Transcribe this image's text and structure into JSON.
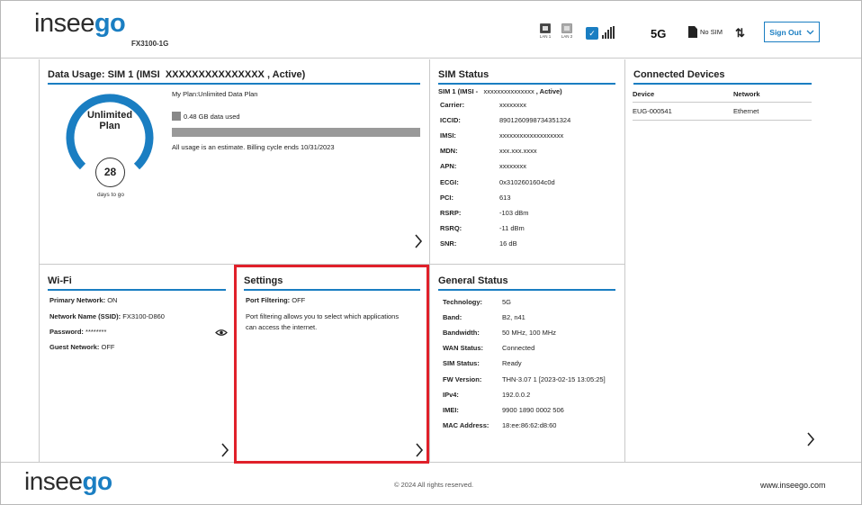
{
  "header": {
    "logo_text": "insee",
    "logo_accent": "go",
    "model": "FX3100-1G",
    "lan1_label": "LAN 1",
    "lan2_label": "LAN 2",
    "network_type": "5G",
    "sim_status": "No SIM",
    "sign_out_label": "Sign Out",
    "accent_color": "#1a7ec2"
  },
  "data_usage": {
    "title_prefix": "Data Usage:  SIM 1 (IMSI",
    "title_imsi": "XXXXXXXXXXXXXXX",
    "title_suffix": ", Active)",
    "gauge_line1": "Unlimited",
    "gauge_line2": "Plan",
    "days_remaining": "28",
    "days_label": "days to go",
    "plan": "My Plan:Unlimited Data Plan",
    "used": "0.48 GB data used",
    "usage_fraction": 0.0,
    "estimate_note": "All usage is an estimate. Billing cycle ends 10/31/2023"
  },
  "sim_status": {
    "title": "SIM Status",
    "sim_line_prefix": "SIM 1 (IMSI -",
    "sim_line_imsi": "xxxxxxxxxxxxxxx",
    "sim_line_suffix": ", Active)",
    "rows": [
      {
        "k": "Carrier:",
        "v": "xxxxxxxx"
      },
      {
        "k": "ICCID:",
        "v": "8901260998734351324"
      },
      {
        "k": "IMSI:",
        "v": "xxxxxxxxxxxxxxxxxxx"
      },
      {
        "k": "MDN:",
        "v": "xxx.xxx.xxxx"
      },
      {
        "k": "APN:",
        "v": "xxxxxxxx"
      },
      {
        "k": "ECGI:",
        "v": "0x3102601604c0d"
      },
      {
        "k": "PCI:",
        "v": "613"
      },
      {
        "k": "RSRP:",
        "v": "-103 dBm"
      },
      {
        "k": "RSRQ:",
        "v": "-11 dBm"
      },
      {
        "k": "SNR:",
        "v": "16 dB"
      }
    ]
  },
  "connected_devices": {
    "title": "Connected Devices",
    "col_device": "Device",
    "col_network": "Network",
    "rows": [
      {
        "device": "EUG-000541",
        "network": "Ethernet"
      }
    ]
  },
  "wifi": {
    "title": "Wi-Fi",
    "primary_k": "Primary Network:",
    "primary_v": " ON",
    "ssid_k": "Network Name (SSID):",
    "ssid_v": " FX3100-D860",
    "password_k": "Password:",
    "password_v": " ********",
    "guest_k": "Guest Network:",
    "guest_v": " OFF"
  },
  "settings": {
    "title": "Settings",
    "port_k": "Port Filtering:",
    "port_v": " OFF",
    "desc_line1": "Port filtering allows you to select which applications",
    "desc_line2": "can access the internet.",
    "highlight_color": "#e0202a"
  },
  "general_status": {
    "title": "General Status",
    "rows": [
      {
        "k": "Technology:",
        "v": "5G"
      },
      {
        "k": "Band:",
        "v": "B2, n41"
      },
      {
        "k": "Bandwidth:",
        "v": "50 MHz, 100 MHz"
      },
      {
        "k": "WAN Status:",
        "v": "Connected"
      },
      {
        "k": "SIM Status:",
        "v": "Ready"
      },
      {
        "k": "FW Version:",
        "v": "THN-3.07 1 [2023-02-15 13:05:25]"
      },
      {
        "k": "IPv4:",
        "v": "192.0.0.2"
      },
      {
        "k": "IMEI:",
        "v": "9900 1890 0002 506"
      },
      {
        "k": "MAC Address:",
        "v": "18:ee:86:62:d8:60"
      }
    ]
  },
  "footer": {
    "logo_text": "insee",
    "logo_accent": "go",
    "copyright": "© 2024 All rights reserved.",
    "website": "www.inseego.com"
  }
}
